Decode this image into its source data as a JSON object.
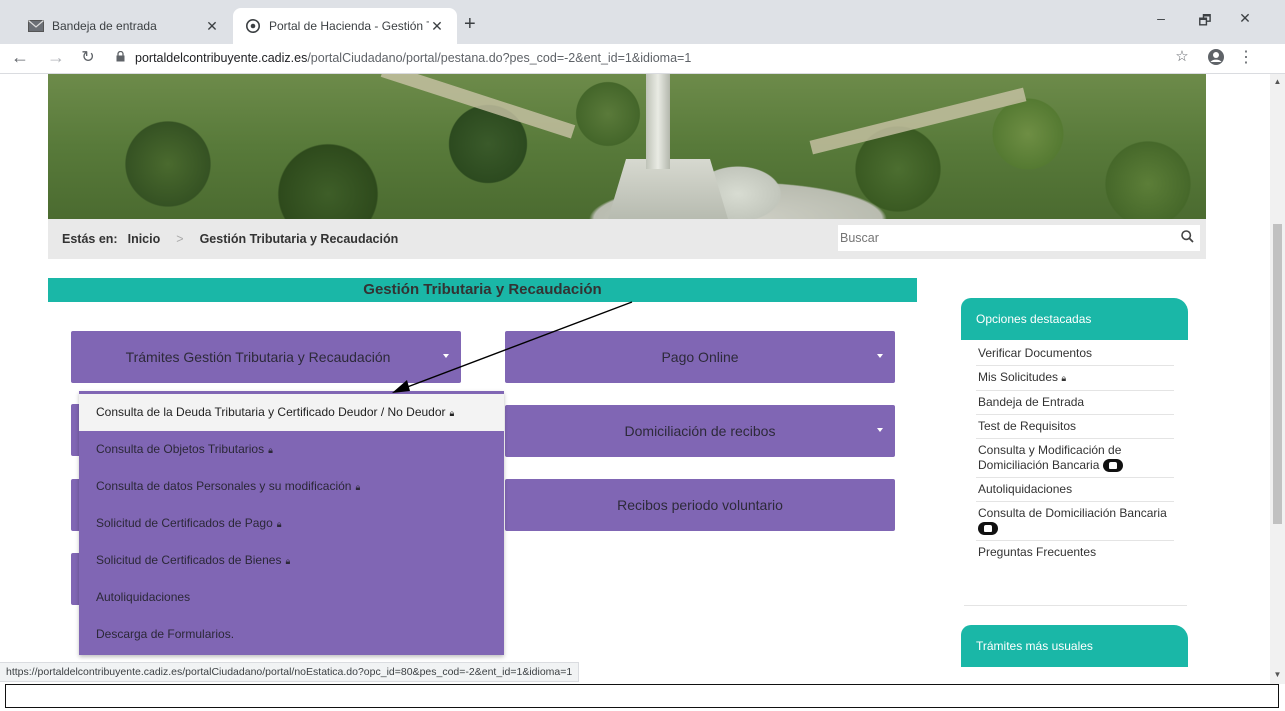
{
  "browser": {
    "tabs": [
      {
        "title": "Bandeja de entrada",
        "icon": "mail-icon",
        "active": false
      },
      {
        "title": "Portal de Hacienda - Gestión Trib",
        "icon": "chrome-icon",
        "active": true
      }
    ],
    "new_tab": "+",
    "url_host": "portaldelcontribuyente.cadiz.es",
    "url_path": "/portalCiudadano/portal/pestana.do?pes_cod=-2&ent_id=1&idioma=1",
    "status_url": "https://portaldelcontribuyente.cadiz.es/portalCiudadano/portal/noEstatica.do?opc_id=80&pes_cod=-2&ent_id=1&idioma=1",
    "window_controls": {
      "minimize": "–",
      "maximize": "🗗",
      "close": "✕"
    }
  },
  "breadcrumb": {
    "prefix": "Estás en:",
    "items": [
      "Inicio",
      "Gestión Tributaria y Recaudación"
    ]
  },
  "search": {
    "placeholder": "Buscar"
  },
  "section_title": "Gestión Tributaria y Recaudación",
  "buttons": {
    "tramites": "Trámites Gestión Tributaria y Recaudación",
    "pago_online": "Pago Online",
    "domiciliacion": "Domiciliación de recibos",
    "recibos": "Recibos periodo voluntario"
  },
  "dropdown": [
    {
      "label": "Consulta de la Deuda Tributaria y Certificado Deudor / No Deudor",
      "lock": "🔒︎"
    },
    {
      "label": "Consulta de Objetos Tributarios",
      "lock": "🔒︎"
    },
    {
      "label": "Consulta de datos Personales y su modificación",
      "lock": "🔒︎"
    },
    {
      "label": "Solicitud de Certificados de Pago",
      "lock": "🔒︎"
    },
    {
      "label": "Solicitud de Certificados de Bienes",
      "lock": "🔒︎"
    },
    {
      "label": "Autoliquidaciones",
      "lock": ""
    },
    {
      "label": "Descarga de Formularios.",
      "lock": ""
    }
  ],
  "sidebar": {
    "featured_title": "Opciones destacadas",
    "featured": [
      "Verificar Documentos",
      "Mis Solicitudes",
      "Bandeja de Entrada",
      "Test de Requisitos",
      "Consulta y Modificación de Domiciliación Bancaria",
      "Autoliquidaciones",
      "Consulta de Domiciliación Bancaria",
      "Preguntas Frecuentes"
    ],
    "usual_title": "Trámites más usuales"
  }
}
